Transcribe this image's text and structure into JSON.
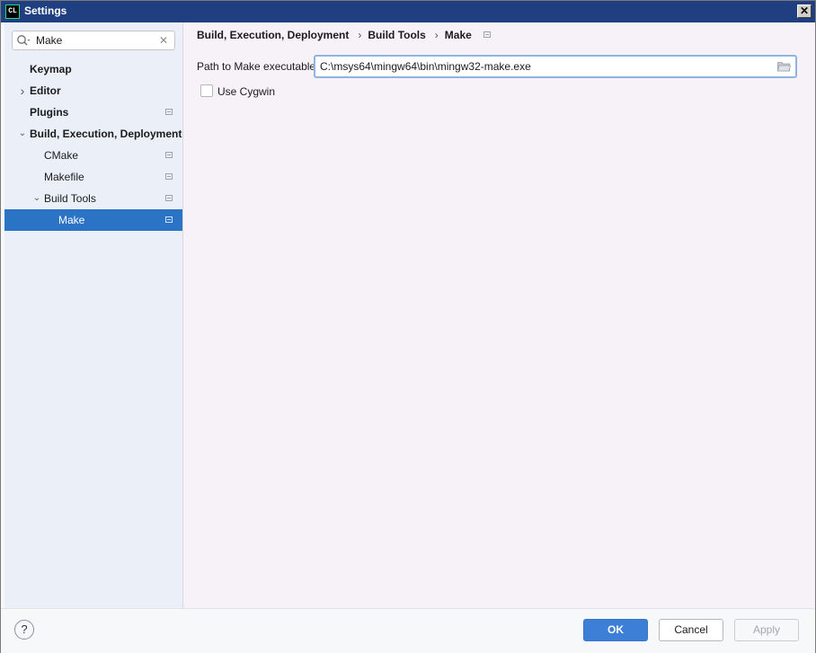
{
  "window": {
    "title": "Settings",
    "app_icon_text": "CL",
    "close_glyph": "✕"
  },
  "search": {
    "value": "Make",
    "clear_glyph": "✕"
  },
  "tree": [
    {
      "label": "Keymap",
      "bold": true,
      "level": 0,
      "arrow": "",
      "project_icon": false,
      "selected": false
    },
    {
      "label": "Editor",
      "bold": true,
      "level": 0,
      "arrow": "›",
      "project_icon": false,
      "selected": false
    },
    {
      "label": "Plugins",
      "bold": true,
      "level": 0,
      "arrow": "",
      "project_icon": true,
      "selected": false
    },
    {
      "label": "Build, Execution, Deployment",
      "bold": true,
      "level": 0,
      "arrow": "⌄",
      "project_icon": false,
      "selected": false
    },
    {
      "label": "CMake",
      "bold": false,
      "level": 1,
      "arrow": "",
      "project_icon": true,
      "selected": false
    },
    {
      "label": "Makefile",
      "bold": false,
      "level": 1,
      "arrow": "",
      "project_icon": true,
      "selected": false
    },
    {
      "label": "Build Tools",
      "bold": false,
      "level": 1,
      "arrow": "⌄",
      "project_icon": true,
      "selected": false
    },
    {
      "label": "Make",
      "bold": false,
      "level": 2,
      "arrow": "",
      "project_icon": true,
      "selected": true
    }
  ],
  "breadcrumb": {
    "items": [
      "Build, Execution, Deployment",
      "Build Tools",
      "Make"
    ],
    "separator": "›"
  },
  "make_settings": {
    "path_label": "Path to Make executable",
    "path_value": "C:\\msys64\\mingw64\\bin\\mingw32-make.exe",
    "use_cygwin_label": "Use Cygwin",
    "use_cygwin_checked": false
  },
  "footer": {
    "help_glyph": "?",
    "ok_label": "OK",
    "cancel_label": "Cancel",
    "apply_label": "Apply"
  },
  "colors": {
    "selection": "#2b73c4",
    "ok_button": "#3d7ed7",
    "title_bar": "#1f3f80"
  }
}
